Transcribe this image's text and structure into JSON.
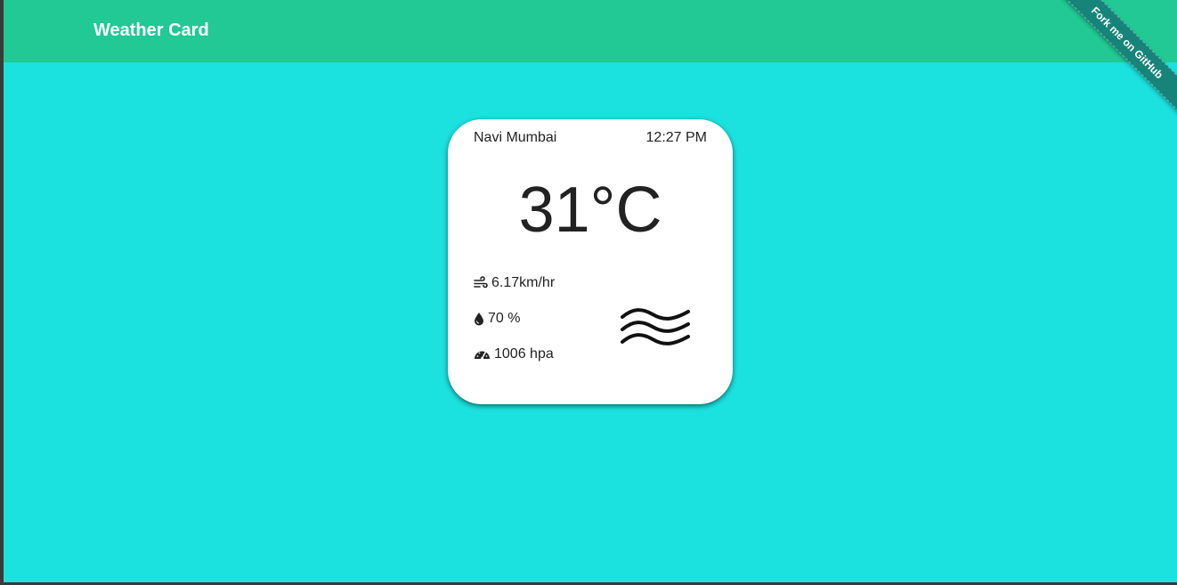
{
  "navbar": {
    "brand": "Weather Card",
    "ribbon_label": "Fork me on GitHub"
  },
  "card": {
    "city": "Navi Mumbai",
    "time": "12:27 PM",
    "temperature": "31°C",
    "wind": "6.17km/hr",
    "humidity": "70 %",
    "pressure": "1006 hpa",
    "condition_icon": "haze-waves-icon"
  },
  "colors": {
    "navbar": "#22c994",
    "background": "#1be1df",
    "ribbon": "#17847a",
    "card": "#ffffff"
  }
}
